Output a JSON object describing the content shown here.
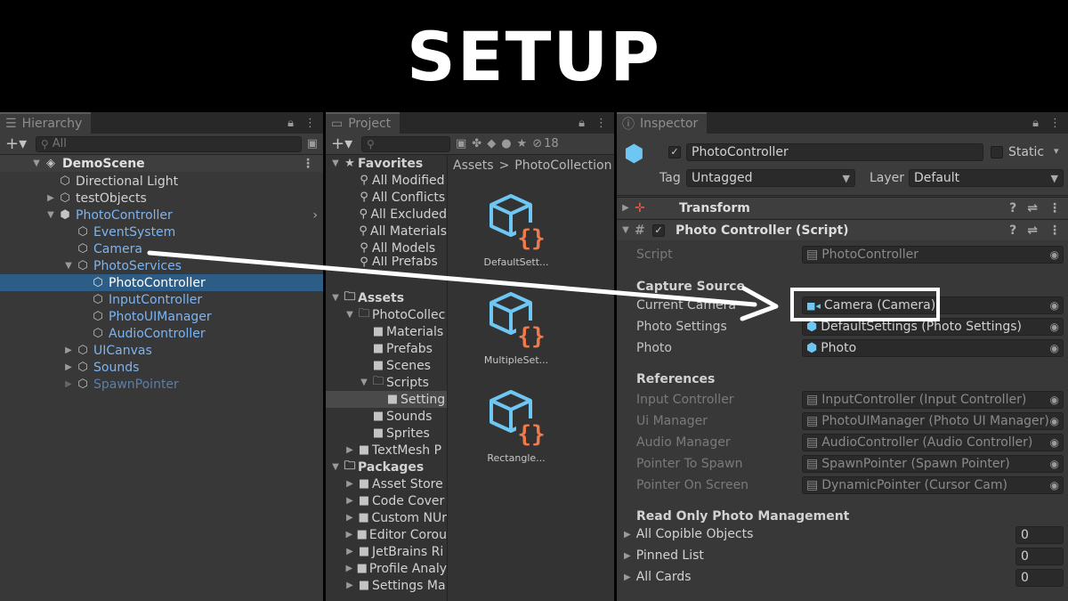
{
  "banner": {
    "title": "SETUP"
  },
  "hierarchy": {
    "tab": "Hierarchy",
    "search_placeholder": "All",
    "scene": "DemoScene",
    "items": [
      {
        "label": "Directional Light",
        "depth": 1
      },
      {
        "label": "testObjects",
        "depth": 1
      },
      {
        "label": "PhotoController",
        "depth": 1
      },
      {
        "label": "EventSystem",
        "depth": 2
      },
      {
        "label": "Camera",
        "depth": 2
      },
      {
        "label": "PhotoServices",
        "depth": 2
      },
      {
        "label": "PhotoController",
        "depth": 3
      },
      {
        "label": "InputController",
        "depth": 3
      },
      {
        "label": "PhotoUIManager",
        "depth": 3
      },
      {
        "label": "AudioController",
        "depth": 3
      },
      {
        "label": "UICanvas",
        "depth": 2
      },
      {
        "label": "Sounds",
        "depth": 2
      },
      {
        "label": "SpawnPointer",
        "depth": 2
      }
    ]
  },
  "project": {
    "tab": "Project",
    "badge": "18",
    "breadcrumb": [
      "Assets",
      "PhotoCollection"
    ],
    "favorites": "Favorites",
    "favorite_items": [
      "All Modified",
      "All Conflicts",
      "All Excluded",
      "All Materials",
      "All Models",
      "All Prefabs"
    ],
    "assets": "Assets",
    "asset_tree": [
      "PhotoCollec",
      "Materials",
      "Prefabs",
      "Scenes",
      "Scripts",
      "Setting",
      "Sounds",
      "Sprites",
      "TextMesh P"
    ],
    "packages": "Packages",
    "package_items": [
      "Asset Store",
      "Code Cover",
      "Custom NUr",
      "Editor Corou",
      "JetBrains Ri",
      "Profile Analy",
      "Settings Ma"
    ],
    "grid_assets": [
      "DefaultSett...",
      "MultipleSet...",
      "Rectangle..."
    ]
  },
  "inspector": {
    "tab": "Inspector",
    "object_name": "PhotoController",
    "static_label": "Static",
    "tag_label": "Tag",
    "tag_value": "Untagged",
    "layer_label": "Layer",
    "layer_value": "Default",
    "transform": "Transform",
    "script_component": "Photo Controller (Script)",
    "script_label": "Script",
    "script_value": "PhotoController",
    "capture_source": "Capture Source",
    "current_camera_label": "Current Camera",
    "current_camera_value": "Camera (Camera)",
    "photo_settings_label": "Photo Settings",
    "photo_settings_value": "DefaultSettings (Photo Settings)",
    "photo_label": "Photo",
    "photo_value": "Photo",
    "references": "References",
    "refs": [
      {
        "label": "Input Controller",
        "value": "InputController  (Input Controller)"
      },
      {
        "label": "Ui Manager",
        "value": "PhotoUIManager  (Photo UI Manager)"
      },
      {
        "label": "Audio Manager",
        "value": "AudioController (Audio Controller)"
      },
      {
        "label": "Pointer To Spawn",
        "value": "SpawnPointer (Spawn Pointer)"
      },
      {
        "label": "Pointer On Screen",
        "value": "DynamicPointer (Cursor Cam)"
      }
    ],
    "readonly_section": "Read Only Photo Management",
    "lists": [
      {
        "label": "All Copible Objects",
        "value": "0"
      },
      {
        "label": "Pinned List",
        "value": "0"
      },
      {
        "label": "All Cards",
        "value": "0"
      }
    ]
  }
}
